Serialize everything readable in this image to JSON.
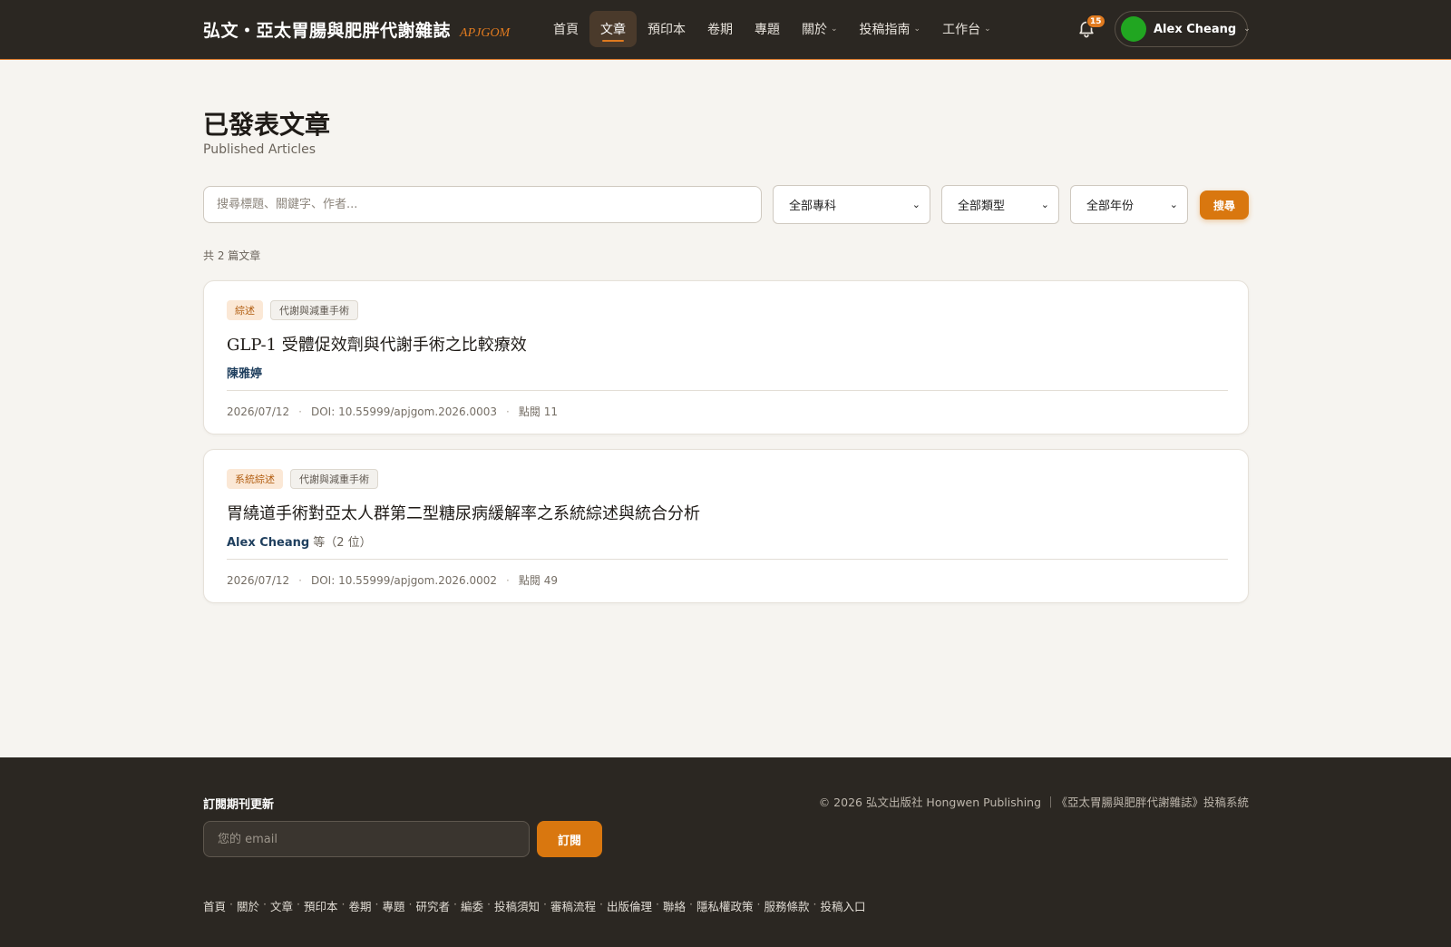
{
  "header": {
    "brand_title": "弘文・亞太胃腸與肥胖代謝雜誌",
    "brand_abbr": "APJGOM",
    "nav": [
      {
        "label": "首頁",
        "active": false,
        "dropdown": false
      },
      {
        "label": "文章",
        "active": true,
        "dropdown": false
      },
      {
        "label": "預印本",
        "active": false,
        "dropdown": false
      },
      {
        "label": "卷期",
        "active": false,
        "dropdown": false
      },
      {
        "label": "專題",
        "active": false,
        "dropdown": false
      },
      {
        "label": "關於",
        "active": false,
        "dropdown": true
      },
      {
        "label": "投稿指南",
        "active": false,
        "dropdown": true
      },
      {
        "label": "工作台",
        "active": false,
        "dropdown": true
      }
    ],
    "notification_count": "15",
    "user_name": "Alex Cheang",
    "icons": {
      "bell": "bell-icon",
      "chevron": "chevron-down-icon"
    }
  },
  "page": {
    "title": "已發表文章",
    "subtitle": "Published Articles"
  },
  "filters": {
    "search_placeholder": "搜尋標題、關鍵字、作者...",
    "dept_selected": "全部專科",
    "type_selected": "全部類型",
    "year_selected": "全部年份",
    "search_button": "搜尋"
  },
  "results": {
    "count_text": "共 2 篇文章"
  },
  "articles": [
    {
      "type_tag": "綜述",
      "field_tag": "代謝與減重手術",
      "title": "GLP-1 受體促效劑與代謝手術之比較療效",
      "author": "陳雅婷",
      "author_suffix": "",
      "date": "2026/07/12",
      "doi": "DOI: 10.55999/apjgom.2026.0003",
      "views": "點閱 11"
    },
    {
      "type_tag": "系統綜述",
      "field_tag": "代謝與減重手術",
      "title": "胃繞道手術對亞太人群第二型糖尿病緩解率之系統綜述與統合分析",
      "author": "Alex Cheang",
      "author_suffix": "等（2 位）",
      "date": "2026/07/12",
      "doi": "DOI: 10.55999/apjgom.2026.0002",
      "views": "點閱 49"
    }
  ],
  "footer": {
    "subscribe_title": "訂閱期刊更新",
    "email_placeholder": "您的 email",
    "subscribe_button": "訂閱",
    "copyright": "© 2026 弘文出版社 Hongwen Publishing ｜《亞太胃腸與肥胖代謝雜誌》投稿系統",
    "links": [
      "首頁",
      "關於",
      "文章",
      "預印本",
      "卷期",
      "專題",
      "研究者",
      "編委",
      "投稿須知",
      "審稿流程",
      "出版倫理",
      "聯絡",
      "隱私權政策",
      "服務條款",
      "投稿入口"
    ],
    "link_separator": "·"
  },
  "colors": {
    "accent": "#d9770f",
    "header_bg": "#2b2722",
    "page_bg": "#f6f4f0",
    "avatar": "#21a621"
  }
}
